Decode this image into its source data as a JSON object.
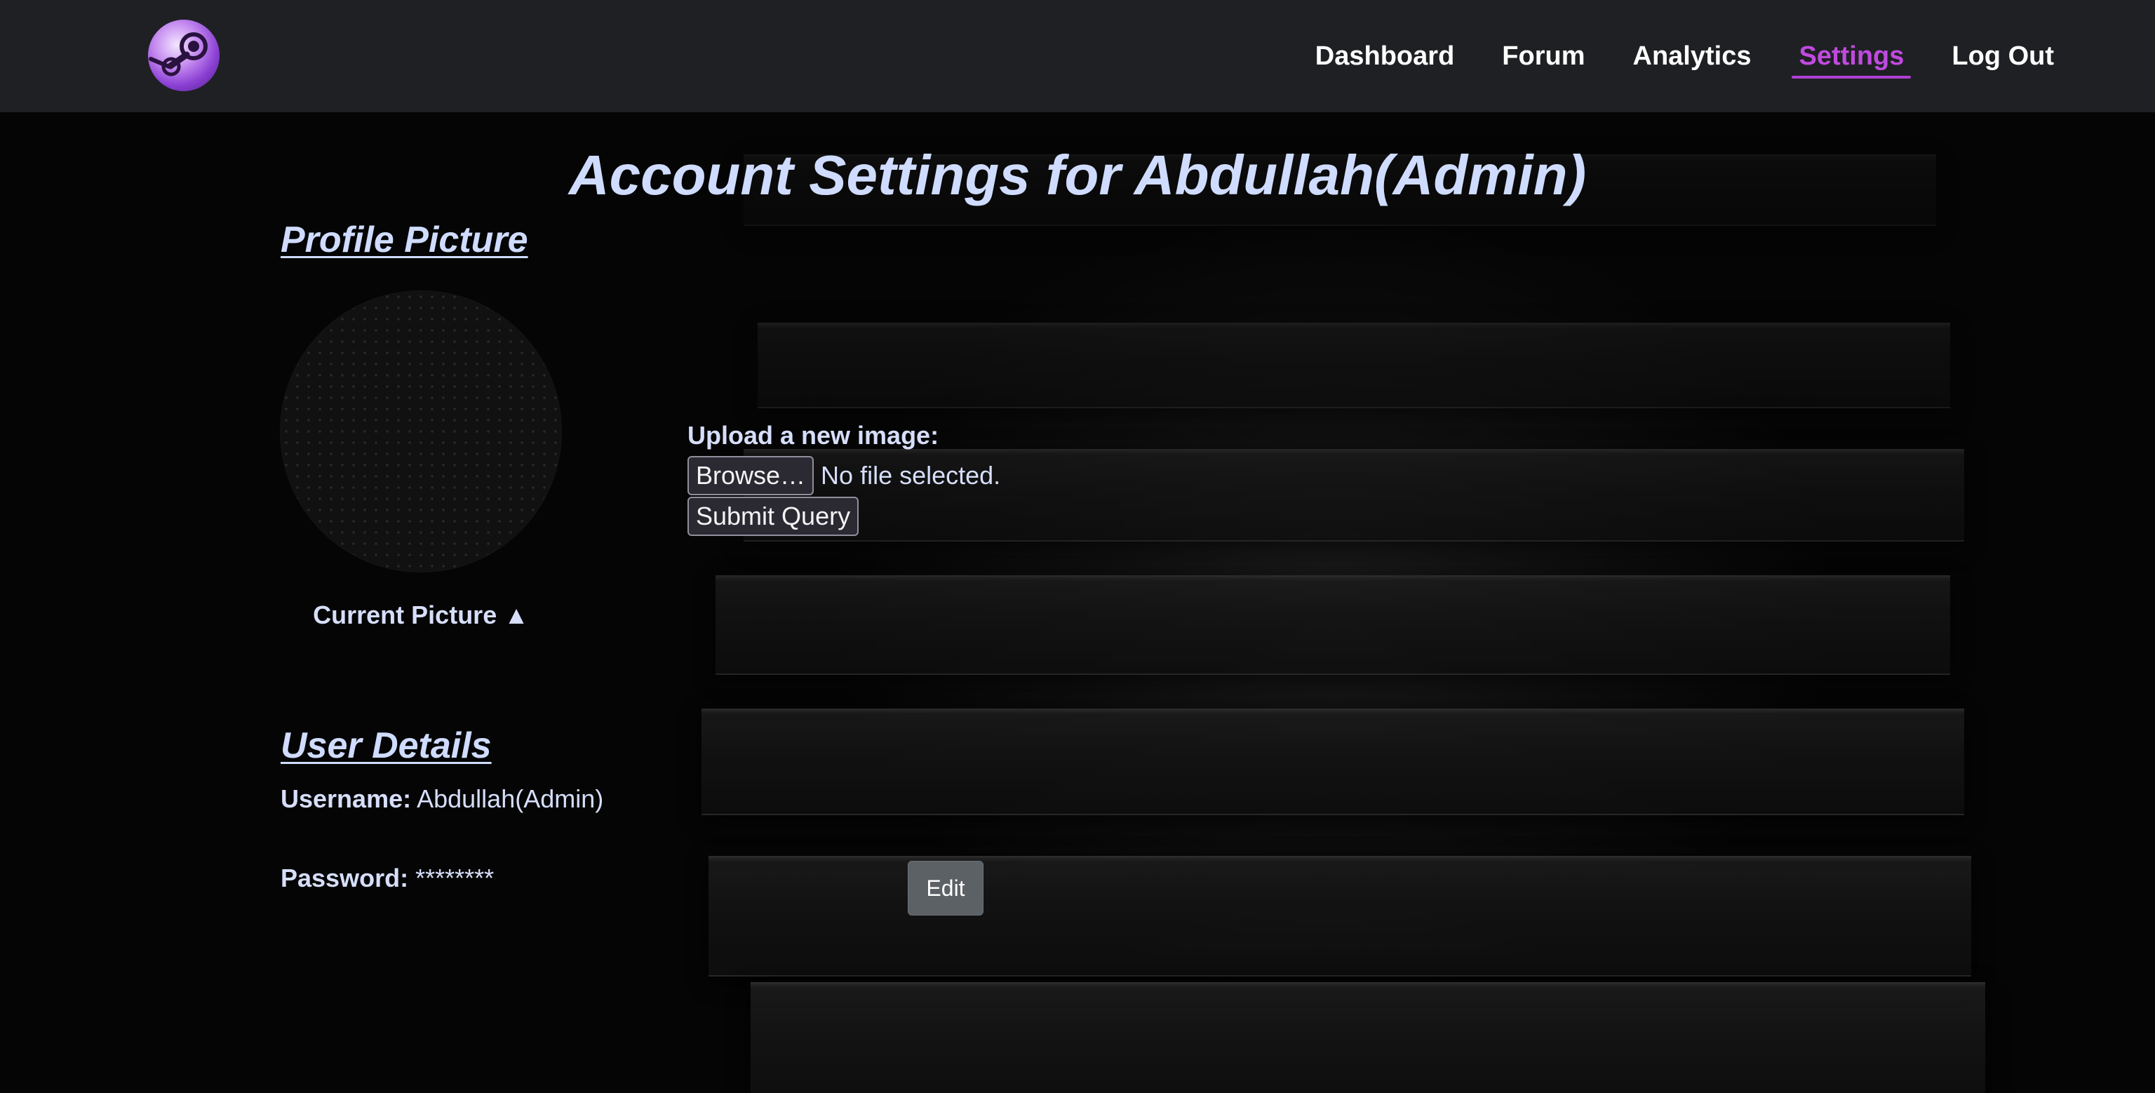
{
  "nav": {
    "logo_icon": "steam-logo-icon",
    "links": [
      "Dashboard",
      "Forum",
      "Analytics",
      "Settings",
      "Log Out"
    ],
    "active": "Settings",
    "active_color": "#c04ae0"
  },
  "page": {
    "title": "Account Settings for Abdullah(Admin)"
  },
  "profile": {
    "heading": "Profile Picture",
    "caption": "Current Picture ▲",
    "upload_label": "Upload a new image:",
    "browse_label": "Browse…",
    "file_status": "No file selected.",
    "submit_label": "Submit Query"
  },
  "details": {
    "heading": "User Details",
    "username_label": "Username:",
    "username_value": "Abdullah(Admin)",
    "password_label": "Password:",
    "password_value": "********",
    "edit_label": "Edit"
  },
  "colors": {
    "heading_text": "#cfdcff",
    "nav_bg": "#1f2023",
    "page_bg": "#050505",
    "edit_button_bg": "#5c6166"
  }
}
